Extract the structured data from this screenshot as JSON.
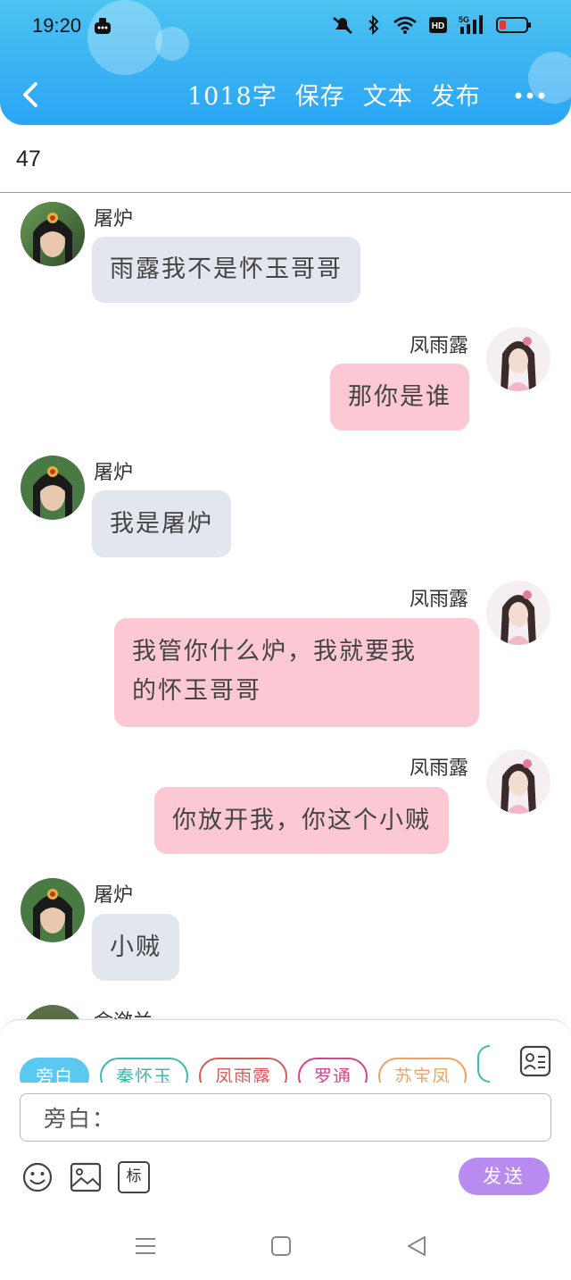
{
  "status": {
    "time": "19:20"
  },
  "nav": {
    "word_count": "1018字",
    "save": "保存",
    "text": "文本",
    "publish": "发布"
  },
  "chapter": {
    "number": "47"
  },
  "messages": [
    {
      "side": "left",
      "name": "屠炉",
      "text": "雨露我不是怀玉哥哥"
    },
    {
      "side": "right",
      "name": "凤雨露",
      "text": "那你是谁"
    },
    {
      "side": "left",
      "name": "屠炉",
      "text": "我是屠炉"
    },
    {
      "side": "right",
      "name": "凤雨露",
      "text_line1": "我管你什么炉，我就要我",
      "text_line2": "的怀玉哥哥"
    },
    {
      "side": "right",
      "name": "凤雨露",
      "text": "你放开我，你这个小贼"
    },
    {
      "side": "left",
      "name": "屠炉",
      "text": "小贼"
    },
    {
      "side": "left",
      "name": "俞潋兰"
    }
  ],
  "characters": [
    "旁白",
    "秦怀玉",
    "凤雨露",
    "罗通",
    "苏宝凤"
  ],
  "input": {
    "value": "旁白："
  },
  "toolbar": {
    "tag_label": "标",
    "send_label": "发送"
  },
  "colors": {
    "header": "#38b0f3",
    "left_bubble": "#e2e6ee",
    "right_bubble": "#fbc8d3",
    "send": "#b78bf0"
  }
}
